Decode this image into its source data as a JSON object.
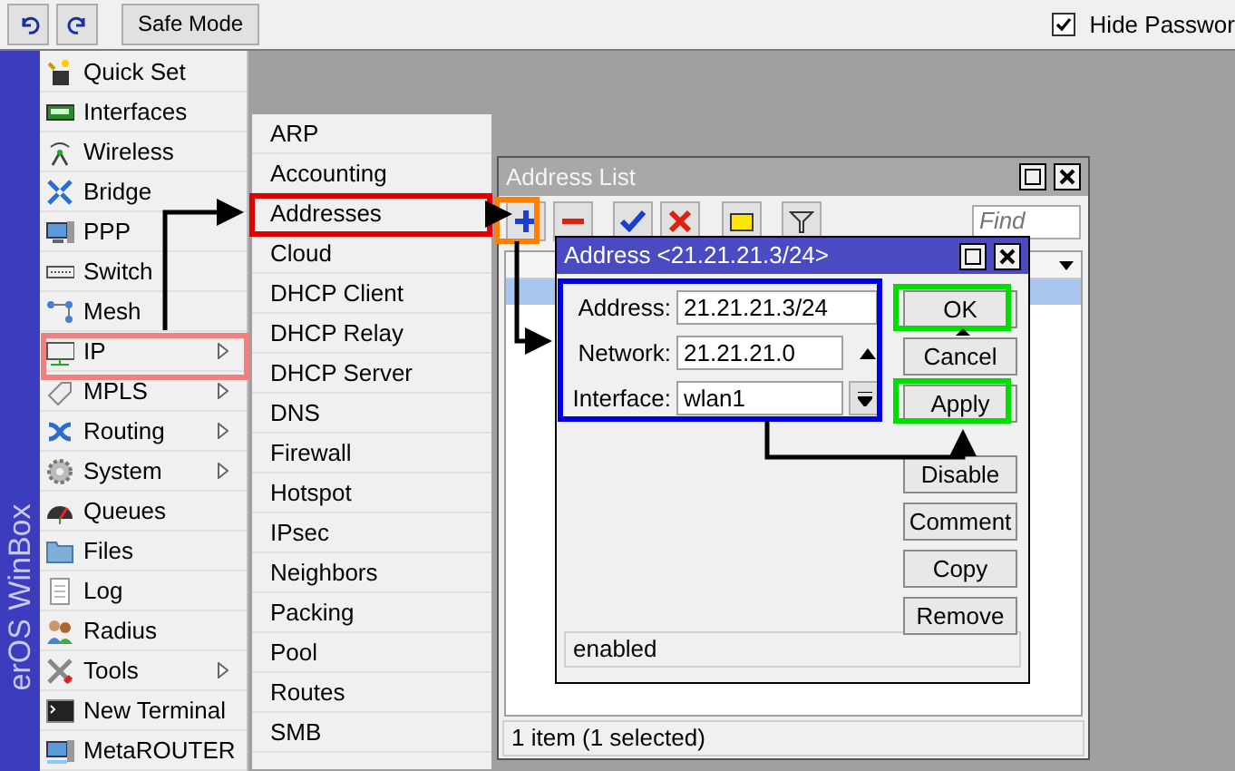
{
  "toolbar": {
    "safe_mode": "Safe Mode",
    "hide_passwords": {
      "label": "Hide Passwor",
      "checked": true
    }
  },
  "sidebar": {
    "brand": "erOS WinBox",
    "items": [
      {
        "label": "Quick Set",
        "submenu": false
      },
      {
        "label": "Interfaces",
        "submenu": false
      },
      {
        "label": "Wireless",
        "submenu": false
      },
      {
        "label": "Bridge",
        "submenu": false
      },
      {
        "label": "PPP",
        "submenu": false
      },
      {
        "label": "Switch",
        "submenu": false
      },
      {
        "label": "Mesh",
        "submenu": false
      },
      {
        "label": "IP",
        "submenu": true
      },
      {
        "label": "MPLS",
        "submenu": true
      },
      {
        "label": "Routing",
        "submenu": true
      },
      {
        "label": "System",
        "submenu": true
      },
      {
        "label": "Queues",
        "submenu": false
      },
      {
        "label": "Files",
        "submenu": false
      },
      {
        "label": "Log",
        "submenu": false
      },
      {
        "label": "Radius",
        "submenu": false
      },
      {
        "label": "Tools",
        "submenu": true
      },
      {
        "label": "New Terminal",
        "submenu": false
      },
      {
        "label": "MetaROUTER",
        "submenu": false
      }
    ]
  },
  "submenu": {
    "items": [
      "ARP",
      "Accounting",
      "Addresses",
      "Cloud",
      "DHCP Client",
      "DHCP Relay",
      "DHCP Server",
      "DNS",
      "Firewall",
      "Hotspot",
      "IPsec",
      "Neighbors",
      "Packing",
      "Pool",
      "Routes",
      "SMB"
    ]
  },
  "address_list": {
    "title": "Address List",
    "find_placeholder": "Find",
    "rows": [
      {
        "selected": true
      }
    ],
    "status": "1 item (1 selected)"
  },
  "dialog": {
    "title": "Address <21.21.21.3/24>",
    "fields": [
      {
        "label": "Address:",
        "value": "21.21.21.3/24",
        "kind": "plain"
      },
      {
        "label": "Network:",
        "value": "21.21.21.0",
        "kind": "toggle"
      },
      {
        "label": "Interface:",
        "value": "wlan1",
        "kind": "dropdown"
      }
    ],
    "buttons": [
      "OK",
      "Cancel",
      "Apply",
      "Disable",
      "Comment",
      "Copy",
      "Remove"
    ],
    "status": "enabled"
  }
}
